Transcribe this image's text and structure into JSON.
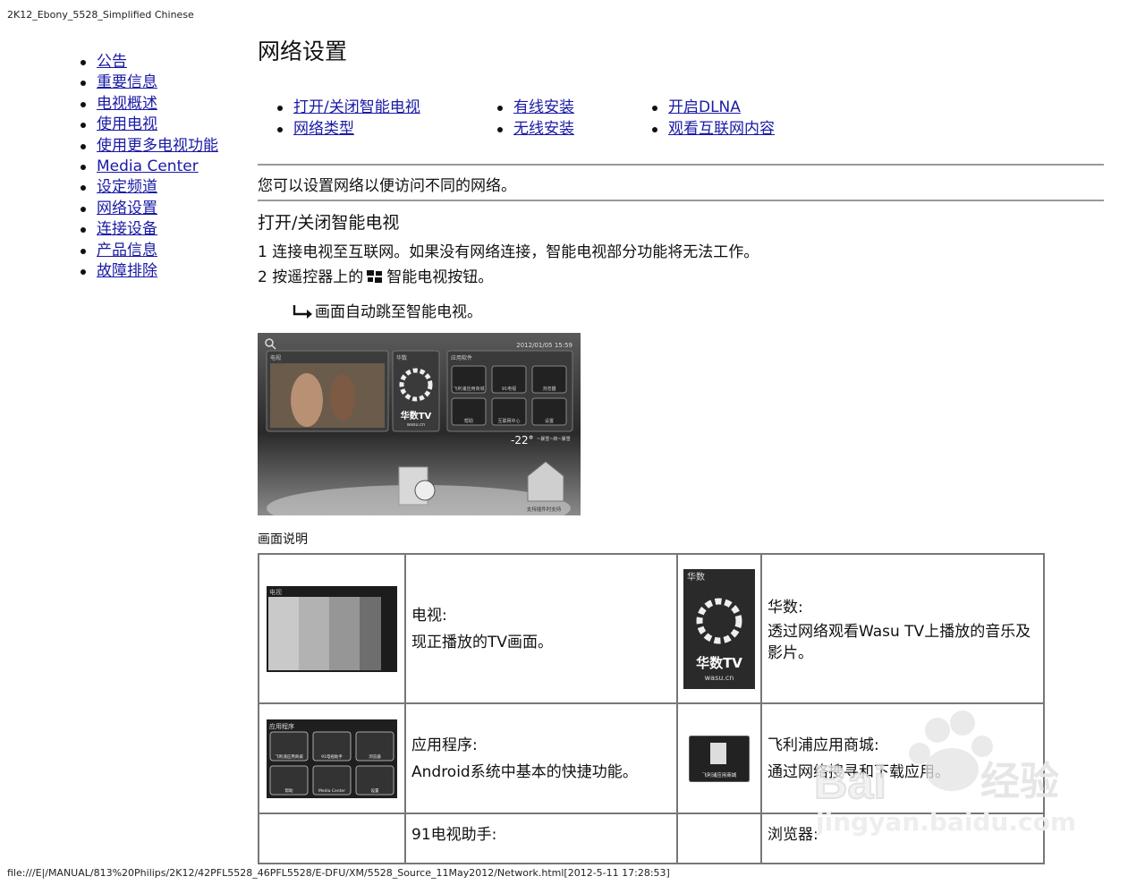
{
  "header": {
    "doc_label": "2K12_Ebony_5528_Simplified Chinese"
  },
  "footer": {
    "path": "file:///E|/MANUAL/813%20Philips/2K12/42PFL5528_46PFL5528/E-DFU/XM/5528_Source_11May2012/Network.html[2012-5-11 17:28:53]"
  },
  "nav": {
    "items": [
      "公告",
      "重要信息",
      "电视概述",
      "使用电视",
      "使用更多电视功能",
      "Media Center",
      "设定频道",
      "网络设置",
      "连接设备",
      "产品信息",
      "故障排除"
    ]
  },
  "page": {
    "title": "网络设置",
    "toc": [
      [
        "打开/关闭智能电视",
        "网络类型"
      ],
      [
        "有线安装",
        "无线安装"
      ],
      [
        "开启DLNA",
        "观看互联网内容"
      ]
    ],
    "intro": "您可以设置网络以便访问不同的网络。",
    "section_title": "打开/关闭智能电视",
    "step1": "1 连接电视至互联网。如果没有网络连接，智能电视部分功能将无法工作。",
    "step2_pre": "2 按遥控器上的",
    "step2_post": "智能电视按钮。",
    "result": "画面自动跳至智能电视。",
    "caption": "画面说明"
  },
  "screenshot": {
    "date": "2012/01/05 15:59",
    "tv_label": "电视",
    "wasu_label": "华数",
    "apps_label": "应用软件",
    "wasu_logo": "华数TV",
    "wasu_domain": "wasu.cn",
    "app_names": [
      "飞利浦应用商城",
      "91电视",
      "浏览器",
      "帮助",
      "互联网中心",
      "设置"
    ],
    "temperature": "-22°",
    "weather_text": "~暴雪~转~暴雪",
    "bottom_text": "支持插件时支持"
  },
  "table": {
    "rows": [
      {
        "left_thumb_label": "电视",
        "left_title": "电视:",
        "left_desc": "现正播放的TV画面。",
        "right_thumb_label": "华数",
        "right_thumb_logo": "华数TV",
        "right_thumb_domain": "wasu.cn",
        "right_title": "华数:",
        "right_desc": "透过网络观看Wasu TV上播放的音乐及影片。"
      },
      {
        "left_thumb_label": "应用程序",
        "left_thumb_apps": [
          "飞利浦应用商城",
          "91电视助手",
          "浏览器",
          "帮助",
          "Media Center",
          "设置"
        ],
        "left_title": "应用程序:",
        "left_desc": "Android系统中基本的快捷功能。",
        "right_thumb_label": "飞利浦应用商城",
        "right_title": "飞利浦应用商城:",
        "right_desc": "通过网络搜寻和下载应用。"
      },
      {
        "left_title": "91电视助手:",
        "right_title": "浏览器:"
      }
    ]
  },
  "watermark": {
    "brand": "Bai",
    "suffix": "经验",
    "url": "jingyan.baidu.com"
  }
}
